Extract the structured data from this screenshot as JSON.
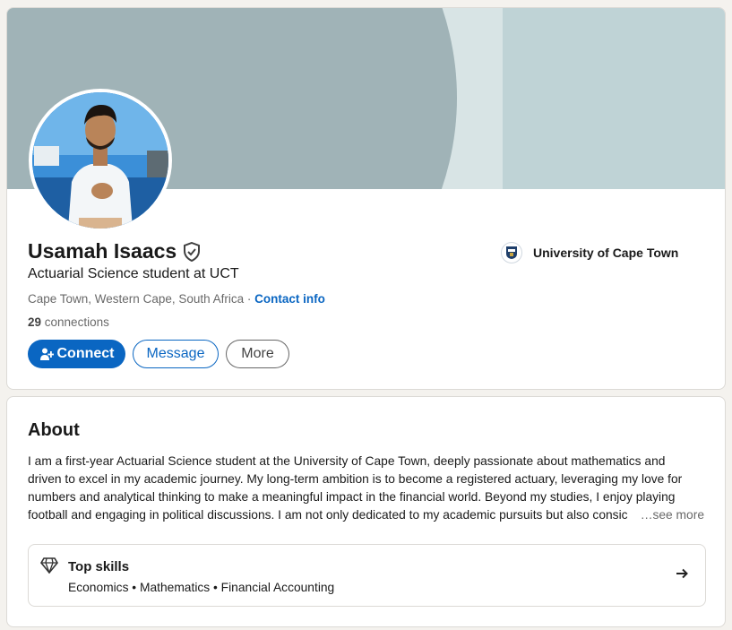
{
  "profile": {
    "name": "Usamah Isaacs",
    "headline": "Actuarial Science student at UCT",
    "location": "Cape Town, Western Cape, South Africa",
    "location_separator": " · ",
    "contact_info_label": "Contact info",
    "connections_count": "29",
    "connections_label": " connections",
    "education": "University of Cape Town",
    "actions": {
      "connect": "Connect",
      "message": "Message",
      "more": "More"
    }
  },
  "about": {
    "title": "About",
    "lines": [
      "I am a first-year Actuarial Science student at the University of Cape Town, deeply passionate about mathematics and",
      "driven to excel in my academic journey. My long-term ambition is to become a registered actuary, leveraging my love for",
      "numbers and analytical thinking to make a meaningful impact in the financial world. Beyond my studies, I enjoy playing",
      "football and engaging in political discussions. I am not only dedicated to my academic pursuits but also consic"
    ],
    "see_more": "…see more"
  },
  "top_skills": {
    "title": "Top skills",
    "list": "Economics • Mathematics • Financial Accounting"
  },
  "colors": {
    "accent": "#0a66c2",
    "banner_light": "#bfd3d6",
    "banner_dark": "#a0b3b7"
  }
}
